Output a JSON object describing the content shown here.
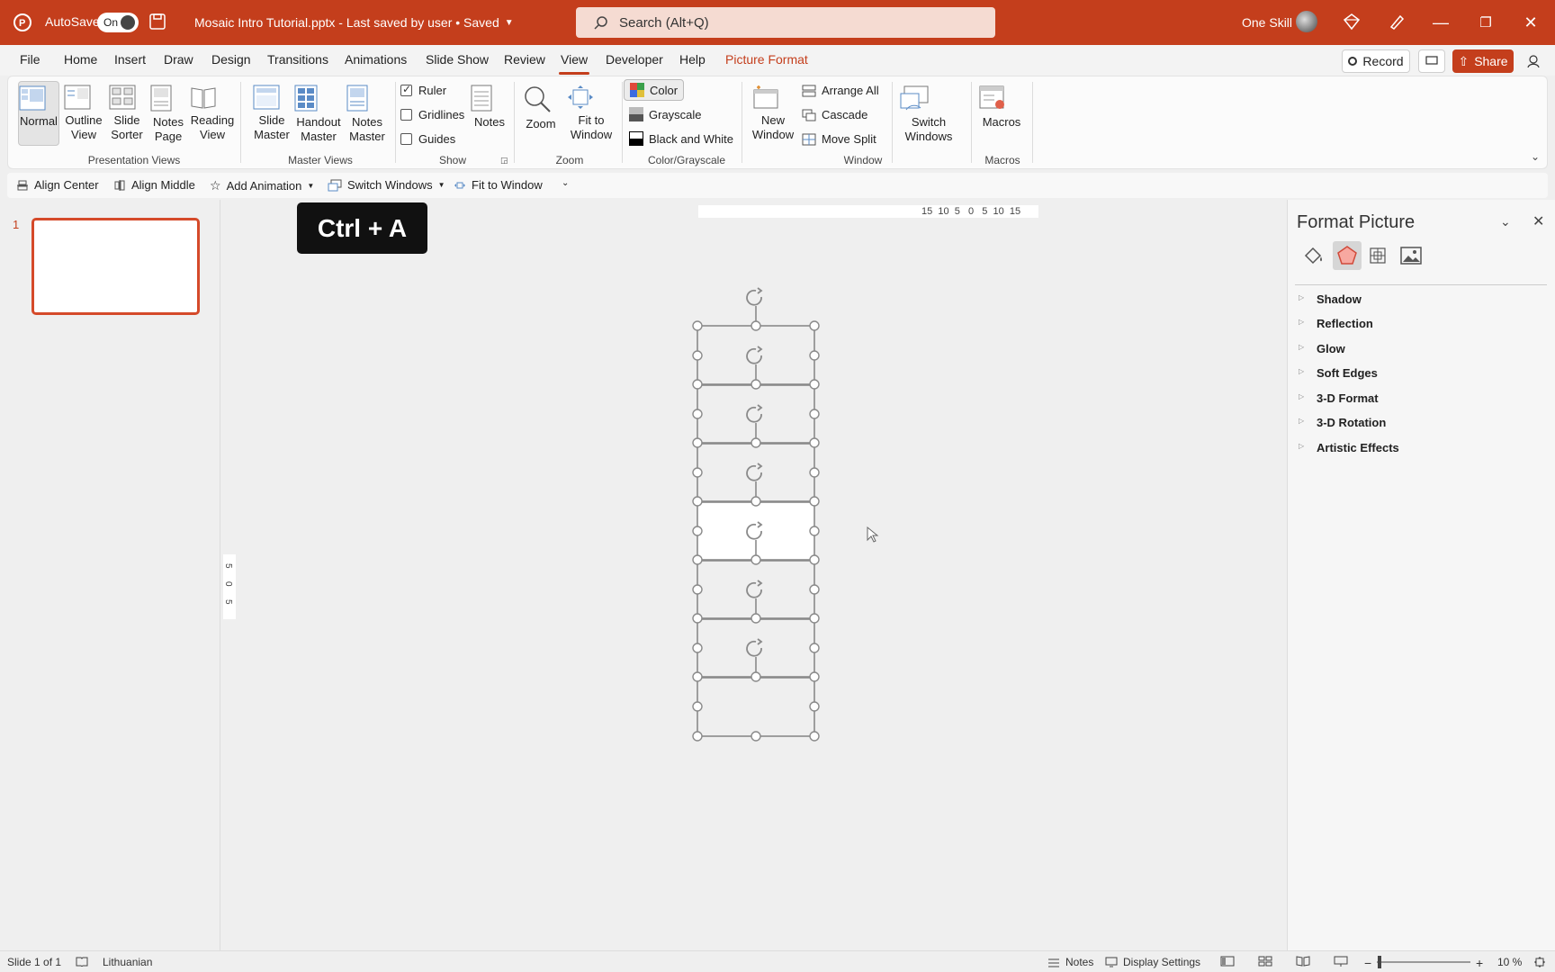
{
  "title_bar": {
    "autosave_label": "AutoSave",
    "autosave_state": "On",
    "document_title": "Mosaic Intro Tutorial.pptx  -  Last saved by user • Saved",
    "search_placeholder": "Search (Alt+Q)",
    "user_name": "One Skill"
  },
  "menu": {
    "items": [
      "File",
      "Home",
      "Insert",
      "Draw",
      "Design",
      "Transitions",
      "Animations",
      "Slide Show",
      "Review",
      "View",
      "Developer",
      "Help",
      "Picture Format"
    ],
    "active": "View",
    "record_label": "Record",
    "share_label": "Share"
  },
  "ribbon": {
    "presentation_views": {
      "label": "Presentation Views",
      "buttons": [
        "Normal",
        "Outline View",
        "Slide Sorter",
        "Notes Page",
        "Reading View"
      ]
    },
    "master_views": {
      "label": "Master Views",
      "buttons": [
        "Slide Master",
        "Handout Master",
        "Notes Master"
      ]
    },
    "show": {
      "label": "Show",
      "ruler": "Ruler",
      "gridlines": "Gridlines",
      "guides": "Guides",
      "notes": "Notes"
    },
    "zoom": {
      "label": "Zoom",
      "zoom": "Zoom",
      "fit": "Fit to Window"
    },
    "color": {
      "label": "Color/Grayscale",
      "color": "Color",
      "grayscale": "Grayscale",
      "bw": "Black and White"
    },
    "window": {
      "label": "Window",
      "new_window": "New Window",
      "arrange_all": "Arrange All",
      "cascade": "Cascade",
      "move_split": "Move Split",
      "switch_windows": "Switch Windows"
    },
    "macros": {
      "label": "Macros",
      "macros": "Macros"
    }
  },
  "qat": {
    "align_center": "Align Center",
    "align_middle": "Align Middle",
    "add_animation": "Add Animation",
    "switch_windows": "Switch Windows",
    "fit_to_window": "Fit to Window"
  },
  "thumbnails": {
    "slide_number": "1"
  },
  "canvas": {
    "shortcut_tip": "Ctrl + A",
    "ruler_h": "15  10  5   0   5  10  15"
  },
  "format_pane": {
    "title": "Format Picture",
    "sections": [
      "Shadow",
      "Reflection",
      "Glow",
      "Soft Edges",
      "3-D Format",
      "3-D Rotation",
      "Artistic Effects"
    ]
  },
  "status": {
    "slide_info": "Slide 1 of 1",
    "language": "Lithuanian",
    "notes": "Notes",
    "display_settings": "Display Settings",
    "zoom_level": "10 %"
  },
  "colors": {
    "accent": "#c43e1c"
  }
}
